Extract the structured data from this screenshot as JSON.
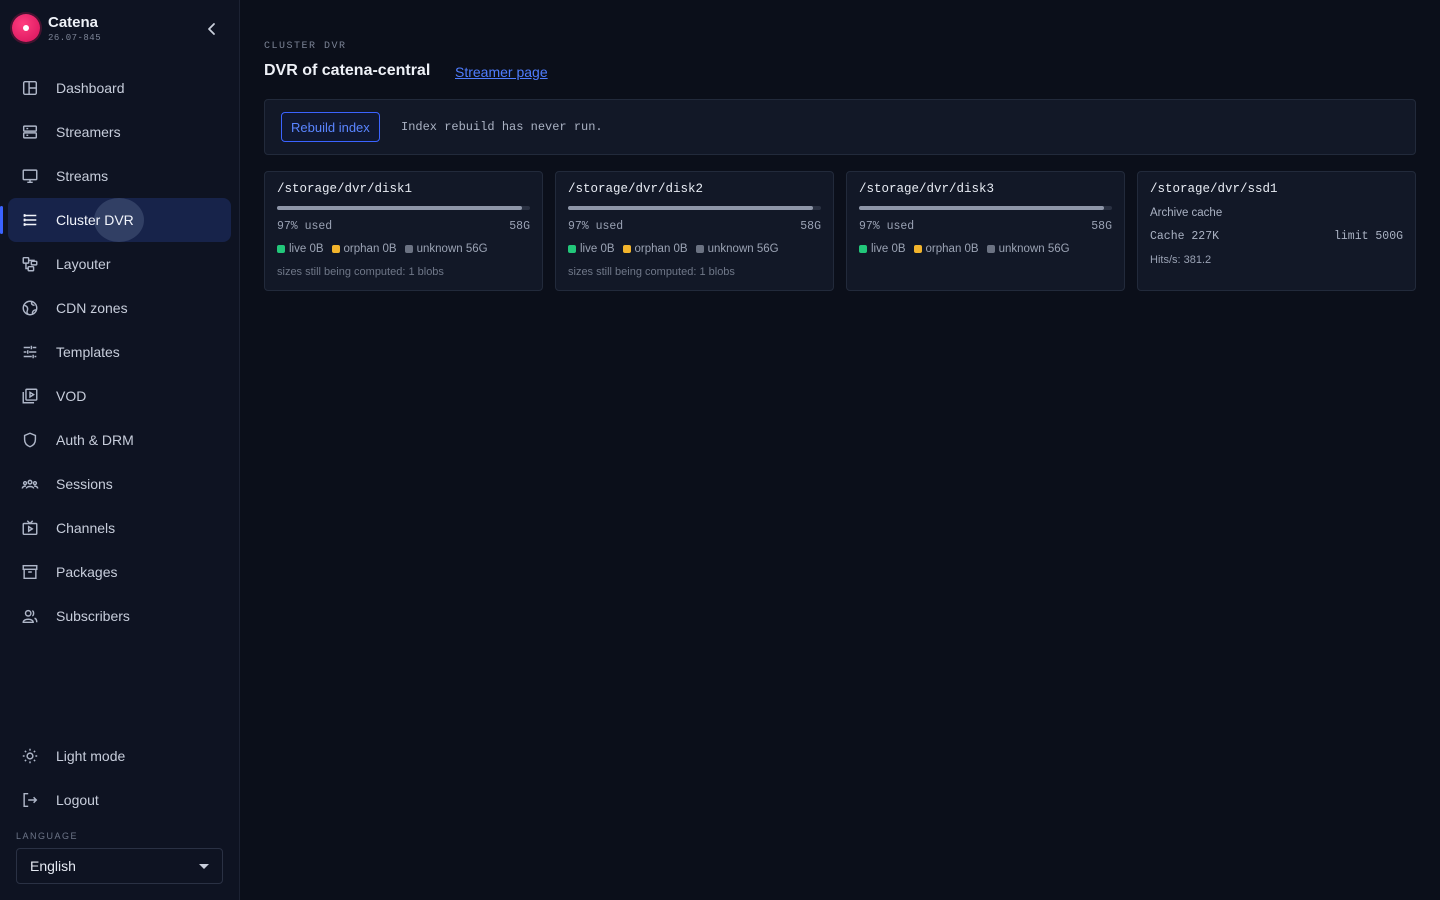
{
  "app": {
    "name": "Catena",
    "version": "26.07-845"
  },
  "nav": {
    "items": [
      {
        "label": "Dashboard",
        "icon": "dashboard-icon"
      },
      {
        "label": "Streamers",
        "icon": "server-icon"
      },
      {
        "label": "Streams",
        "icon": "monitor-icon"
      },
      {
        "label": "Cluster DVR",
        "icon": "list-icon",
        "active": true
      },
      {
        "label": "Layouter",
        "icon": "layout-icon"
      },
      {
        "label": "CDN zones",
        "icon": "globe-icon"
      },
      {
        "label": "Templates",
        "icon": "sliders-icon"
      },
      {
        "label": "VOD",
        "icon": "video-library-icon"
      },
      {
        "label": "Auth & DRM",
        "icon": "shield-icon"
      },
      {
        "label": "Sessions",
        "icon": "group-icon"
      },
      {
        "label": "Channels",
        "icon": "tv-icon"
      },
      {
        "label": "Packages",
        "icon": "archive-box-icon"
      },
      {
        "label": "Subscribers",
        "icon": "users-icon"
      }
    ],
    "bottom": [
      {
        "label": "Light mode",
        "icon": "sun-icon"
      },
      {
        "label": "Logout",
        "icon": "logout-icon"
      }
    ]
  },
  "language": {
    "label": "LANGUAGE",
    "value": "English"
  },
  "page": {
    "section": "CLUSTER DVR",
    "title": "DVR of catena-central",
    "link": "Streamer page"
  },
  "rebuild": {
    "button": "Rebuild index",
    "status": "Index rebuild has never run."
  },
  "disks": [
    {
      "path": "/storage/dvr/disk1",
      "used_label": "97% used",
      "used_fraction": 0.97,
      "total": "58G",
      "live": "live 0B",
      "orphan": "orphan 0B",
      "unknown": "unknown 56G",
      "note": "sizes still being computed: 1 blobs"
    },
    {
      "path": "/storage/dvr/disk2",
      "used_label": "97% used",
      "used_fraction": 0.97,
      "total": "58G",
      "live": "live 0B",
      "orphan": "orphan 0B",
      "unknown": "unknown 56G",
      "note": "sizes still being computed: 1 blobs"
    },
    {
      "path": "/storage/dvr/disk3",
      "used_label": "97% used",
      "used_fraction": 0.97,
      "total": "58G",
      "live": "live 0B",
      "orphan": "orphan 0B",
      "unknown": "unknown 56G",
      "note": ""
    }
  ],
  "cache": {
    "path": "/storage/dvr/ssd1",
    "type": "Archive cache",
    "size": "Cache 227K",
    "limit": "limit 500G",
    "hits": "Hits/s: 381.2"
  },
  "colors": {
    "live": "#22c77a",
    "orphan": "#f2b42c",
    "unknown": "#6b7282",
    "accent": "#3b63ff"
  }
}
